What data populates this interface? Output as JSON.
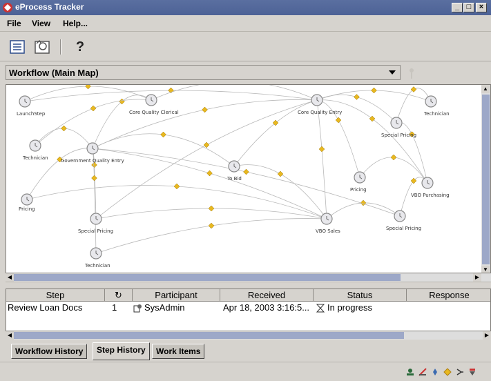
{
  "window": {
    "title": "eProcess Tracker"
  },
  "menu": {
    "file": "File",
    "view": "View",
    "help": "Help..."
  },
  "toolbar": {
    "help_label": "?"
  },
  "workflow_select": {
    "selected": "Workflow (Main Map)"
  },
  "map": {
    "nodes": [
      {
        "label": "LaunchStep"
      },
      {
        "label": "Core Quality Clerical"
      },
      {
        "label": "Core Quality Entry"
      },
      {
        "label": "Technician"
      },
      {
        "label": "Special Pricing"
      },
      {
        "label": "Technician"
      },
      {
        "label": "Government Quality Entry"
      },
      {
        "label": "To Bid"
      },
      {
        "label": "Pricing"
      },
      {
        "label": "VBO Purchasing"
      },
      {
        "label": "Pricing"
      },
      {
        "label": "Special Pricing"
      },
      {
        "label": "VBO Sales"
      },
      {
        "label": "Special Pricing"
      },
      {
        "label": "Technician"
      }
    ]
  },
  "table": {
    "headers": {
      "step": "Step",
      "count_icon": "↻",
      "participant": "Participant",
      "received": "Received",
      "status": "Status",
      "response": "Response"
    },
    "rows": [
      {
        "step": "Review Loan Docs",
        "count": "1",
        "participant": "SysAdmin",
        "received": "Apr 18, 2003 3:16:5...",
        "status": "In progress",
        "response": ""
      }
    ]
  },
  "tabs": {
    "workflow_history": "Workflow History",
    "step_history": "Step History",
    "work_items": "Work Items"
  },
  "colors": {
    "titlebar": "#4d6296",
    "chrome": "#d6d3ce",
    "scroll_thumb": "#9da8c8",
    "diamond": "#e8b820"
  }
}
